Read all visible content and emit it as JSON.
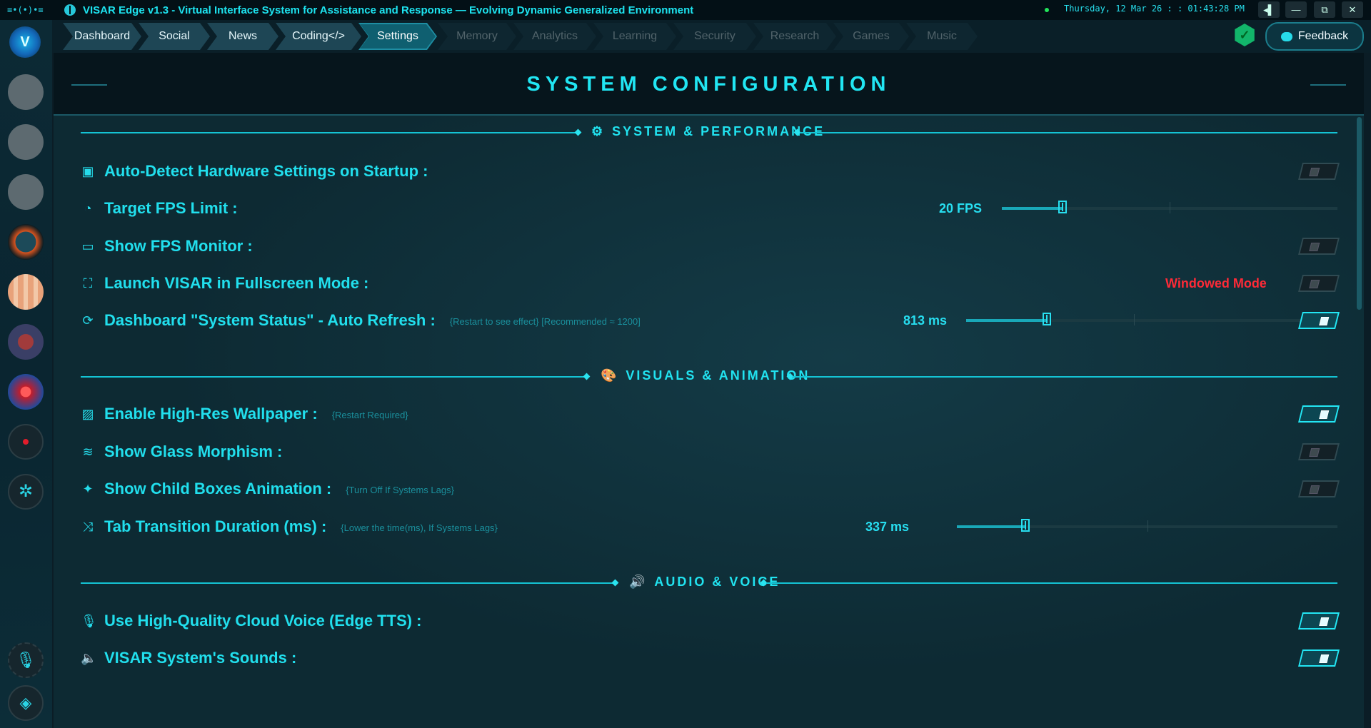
{
  "titlebar": {
    "logo": "≡•(•)•≡",
    "title": "VISAR Edge v1.3 - Virtual Interface System for Assistance and Response — Evolving Dynamic Generalized Environment",
    "clock": "Thursday, 12 Mar 26 : : 01:43:28 PM",
    "buttons": {
      "side": "◂▌",
      "minimize": "—",
      "restore": "⧉",
      "close": "✕"
    }
  },
  "rail": {
    "logo": "V"
  },
  "nav": {
    "tabs": [
      {
        "label": "Dashboard",
        "state": "active"
      },
      {
        "label": "Social",
        "state": "active"
      },
      {
        "label": "News",
        "state": "active"
      },
      {
        "label": "Coding</>",
        "state": "active"
      },
      {
        "label": "Settings",
        "state": "selected"
      },
      {
        "label": "Memory",
        "state": "disabled"
      },
      {
        "label": "Analytics",
        "state": "disabled"
      },
      {
        "label": "Learning",
        "state": "disabled"
      },
      {
        "label": "Security",
        "state": "disabled"
      },
      {
        "label": "Research",
        "state": "disabled"
      },
      {
        "label": "Games",
        "state": "disabled"
      },
      {
        "label": "Music",
        "state": "disabled"
      }
    ],
    "status_check": "✓",
    "feedback_label": "Feedback"
  },
  "page": {
    "title": "SYSTEM CONFIGURATION"
  },
  "sections": {
    "system": {
      "title": "SYSTEM & PERFORMANCE",
      "icon": "gear-icon",
      "auto_detect": {
        "label": "Auto-Detect Hardware Settings on Startup :",
        "enabled": false
      },
      "fps_limit": {
        "label": "Target FPS Limit :",
        "value_text": "20 FPS",
        "fraction": 0.18
      },
      "fps_monitor": {
        "label": "Show FPS Monitor :",
        "enabled": false
      },
      "fullscreen": {
        "label": "Launch VISAR in Fullscreen Mode :",
        "status": "Windowed Mode",
        "enabled": false
      },
      "auto_refresh": {
        "label": "Dashboard \"System Status\" - Auto Refresh :",
        "note": "{Restart to see effect}  [Recommended ≈ 1200]",
        "value_text": "813 ms",
        "fraction": 0.24,
        "enabled": true
      }
    },
    "visuals": {
      "title": "VISUALS & ANIMATION",
      "icon": "palette-icon",
      "wallpaper": {
        "label": "Enable High-Res Wallpaper :",
        "note": "{Restart Required}",
        "enabled": true
      },
      "glass": {
        "label": "Show Glass Morphism :",
        "enabled": false
      },
      "child_boxes": {
        "label": "Show Child Boxes Animation :",
        "note": "{Turn Off If Systems Lags}",
        "enabled": false
      },
      "transition": {
        "label": "Tab Transition Duration (ms) :",
        "note": "{Lower the time(ms), If Systems Lags}",
        "value_text": "337 ms",
        "fraction": 0.18
      }
    },
    "audio": {
      "title": "AUDIO & VOICE",
      "icon": "speaker-icon",
      "cloud_voice": {
        "label": "Use High-Quality Cloud Voice (Edge TTS) :",
        "enabled": true
      },
      "system_sounds": {
        "label": "VISAR System's Sounds :",
        "enabled": true
      }
    }
  },
  "colors": {
    "accent": "#21e3f0",
    "warning": "#ff2a37",
    "background": "#0d2a33"
  }
}
